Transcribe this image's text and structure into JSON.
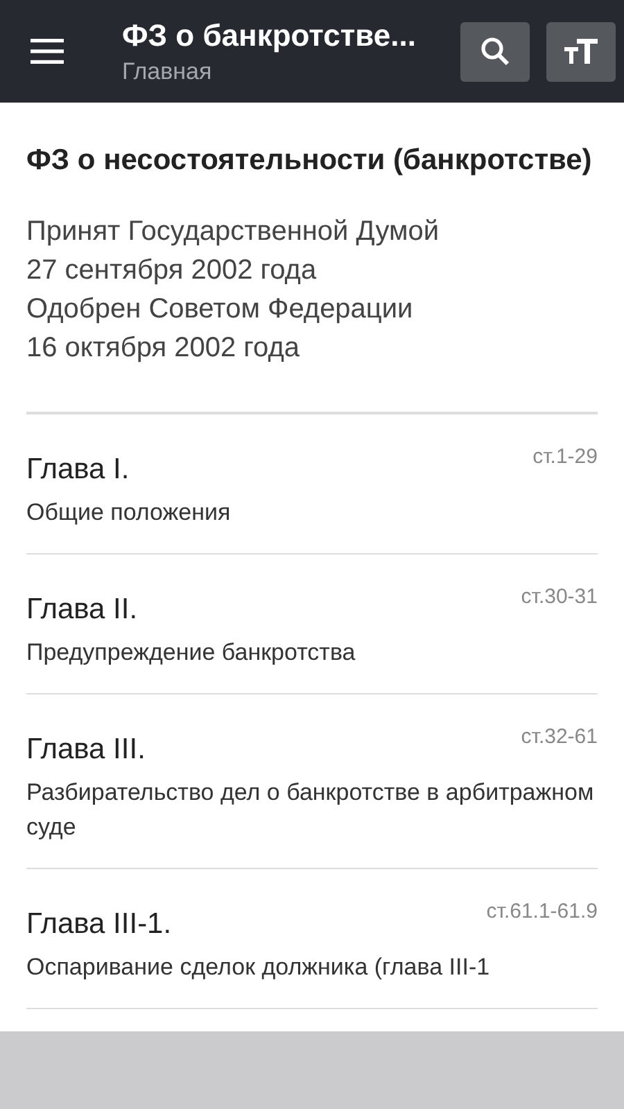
{
  "toolbar": {
    "title": "ФЗ о банкротстве...",
    "subtitle": "Главная"
  },
  "document": {
    "title": "ФЗ о несостоятельности (банкротстве)",
    "adoption": [
      "Принят Государственной Думой",
      "27 сентября 2002 года",
      "Одобрен Советом Федерации",
      "16 октября  2002 года"
    ]
  },
  "chapters": [
    {
      "name": "Глава I.",
      "articles": "ст.1-29",
      "description": "Общие положения"
    },
    {
      "name": "Глава II.",
      "articles": "ст.30-31",
      "description": "Предупреждение банкротства"
    },
    {
      "name": "Глава III.",
      "articles": "ст.32-61",
      "description": "Разбирательство дел о банкротстве в арбитражном суде"
    },
    {
      "name": "Глава III-1.",
      "articles": "ст.61.1-61.9",
      "description": "Оспаривание сделок должника (глава III-1"
    }
  ]
}
